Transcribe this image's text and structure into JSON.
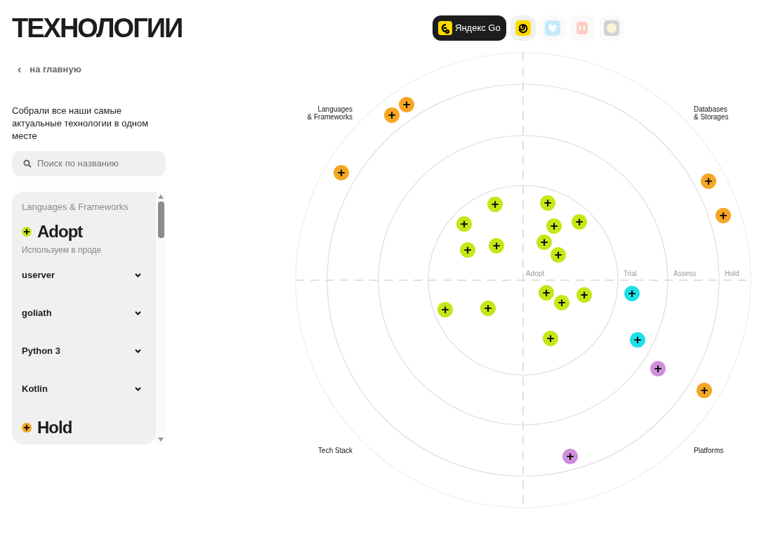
{
  "title": "ТЕХНОЛОГИИ",
  "back_link": {
    "icon": "‹",
    "label": "на главную"
  },
  "description": "Собрали все наши самые актуальные технологии в одном месте",
  "search": {
    "placeholder": "Поиск по названию"
  },
  "apps": [
    {
      "kind": "brand",
      "label": "Яндекс Go",
      "selected": true
    },
    {
      "kind": "spiral",
      "selected": false
    },
    {
      "kind": "heart",
      "selected": false
    },
    {
      "kind": "box",
      "selected": false
    },
    {
      "kind": "blob",
      "selected": false
    }
  ],
  "list": {
    "category": "Languages & Frameworks",
    "sections": [
      {
        "ring": "Adopt",
        "color": "#c6e616",
        "subtitle": "Используем в проде",
        "items": [
          {
            "name": "userver",
            "expanded": false
          },
          {
            "name": "goliath",
            "expanded": false
          },
          {
            "name": "Python 3",
            "expanded": false
          },
          {
            "name": "Kotlin",
            "expanded": false
          }
        ]
      },
      {
        "ring": "Hold",
        "color": "#f5a623"
      }
    ]
  },
  "radar": {
    "quadrants": [
      "Languages\n& Frameworks",
      "Databases\n& Storages",
      "Tech Stack",
      "Platforms"
    ],
    "rings": [
      "Adopt",
      "Trial",
      "Assess",
      "Hold"
    ],
    "blip_symbol": "+",
    "blips": [
      {
        "color": "#f5a623"
      },
      {
        "color": "#f5a623"
      },
      {
        "color": "#f5a623"
      },
      {
        "color": "#f5a623"
      },
      {
        "color": "#f5a623"
      },
      {
        "color": "#f5a623"
      },
      {
        "color": "#c6e616"
      },
      {
        "color": "#c6e616"
      },
      {
        "color": "#c6e616"
      },
      {
        "color": "#c6e616"
      },
      {
        "color": "#c6e616"
      },
      {
        "color": "#c6e616"
      },
      {
        "color": "#c6e616"
      },
      {
        "color": "#c6e616"
      },
      {
        "color": "#c6e616"
      },
      {
        "color": "#c6e616"
      },
      {
        "color": "#c6e616"
      },
      {
        "color": "#c6e616"
      },
      {
        "color": "#c6e616"
      },
      {
        "color": "#c6e616"
      },
      {
        "color": "#c6e616"
      },
      {
        "color": "#1de0e8"
      },
      {
        "color": "#1de0e8"
      },
      {
        "color": "#cf8fdc"
      },
      {
        "color": "#cf8fdc"
      }
    ]
  }
}
